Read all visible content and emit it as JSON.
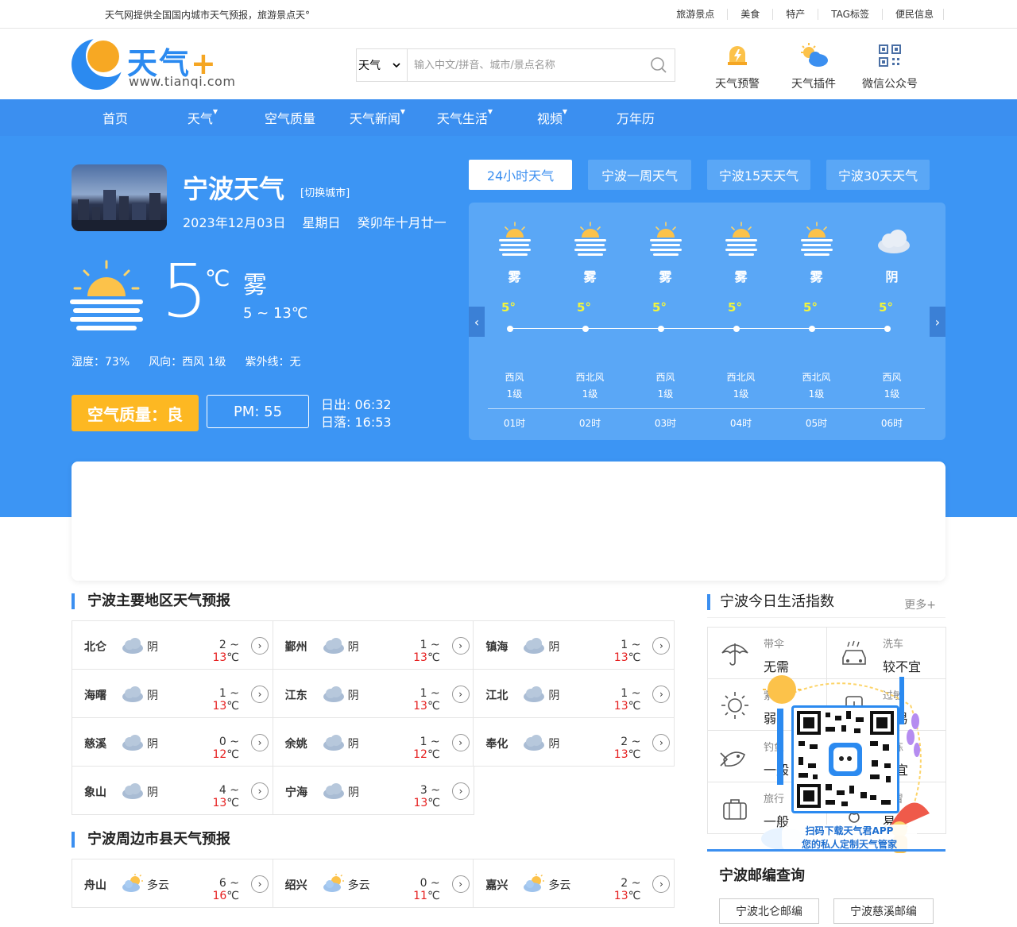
{
  "topbar": {
    "slogan": "天气网提供全国国内城市天气预报，旅游景点天°",
    "links": [
      "旅游景点",
      "美食",
      "特产",
      "TAG标签",
      "便民信息"
    ]
  },
  "logo": {
    "text_main": "天气",
    "text_plus": "+",
    "domain": "www.tianqi.com"
  },
  "search": {
    "select_value": "天气",
    "placeholder": "输入中文/拼音、城市/景点名称"
  },
  "tools": [
    {
      "label": "天气预警",
      "icon": "warning-icon"
    },
    {
      "label": "天气插件",
      "icon": "weather-plugin-icon"
    },
    {
      "label": "微信公众号",
      "icon": "qr-code-icon"
    }
  ],
  "nav": [
    {
      "label": "首页",
      "dropdown": false
    },
    {
      "label": "天气",
      "dropdown": true
    },
    {
      "label": "空气质量",
      "dropdown": false
    },
    {
      "label": "天气新闻",
      "dropdown": true
    },
    {
      "label": "天气生活",
      "dropdown": true
    },
    {
      "label": "视频",
      "dropdown": true
    },
    {
      "label": "万年历",
      "dropdown": false
    }
  ],
  "current": {
    "city_title": "宁波天气",
    "switch_city": "[切换城市]",
    "date": "2023年12月03日",
    "weekday": "星期日",
    "lunar": "癸卯年十月廿一",
    "temp": "5",
    "unit": "℃",
    "condition": "雾",
    "range": "5 ~ 13℃",
    "humidity": "湿度：73%",
    "wind": "风向：西风 1级",
    "uv": "紫外线：无",
    "air_quality": "空气质量：良",
    "pm": "PM: 55",
    "sunrise": "日出: 06:32",
    "sunset": "日落: 16:53"
  },
  "tabs": [
    "24小时天气",
    "宁波一周天气",
    "宁波15天天气",
    "宁波30天天气"
  ],
  "hourly": [
    {
      "cond": "雾",
      "temp": "5°",
      "wind_dir": "西风",
      "wind_lvl": "1级",
      "hour": "01时",
      "icon": "fog-icon"
    },
    {
      "cond": "雾",
      "temp": "5°",
      "wind_dir": "西北风",
      "wind_lvl": "1级",
      "hour": "02时",
      "icon": "fog-icon"
    },
    {
      "cond": "雾",
      "temp": "5°",
      "wind_dir": "西风",
      "wind_lvl": "1级",
      "hour": "03时",
      "icon": "fog-icon"
    },
    {
      "cond": "雾",
      "temp": "5°",
      "wind_dir": "西北风",
      "wind_lvl": "1级",
      "hour": "04时",
      "icon": "fog-icon"
    },
    {
      "cond": "雾",
      "temp": "5°",
      "wind_dir": "西北风",
      "wind_lvl": "1级",
      "hour": "05时",
      "icon": "fog-icon"
    },
    {
      "cond": "阴",
      "temp": "5°",
      "wind_dir": "西风",
      "wind_lvl": "1级",
      "hour": "06时",
      "icon": "overcast-icon"
    }
  ],
  "main_areas": {
    "title": "宁波主要地区天气预报",
    "items": [
      {
        "name": "北仑",
        "cond": "阴",
        "low": "2 ~ ",
        "high": "13",
        "unit": "℃"
      },
      {
        "name": "鄞州",
        "cond": "阴",
        "low": "1 ~ ",
        "high": "13",
        "unit": "℃"
      },
      {
        "name": "镇海",
        "cond": "阴",
        "low": "1 ~ ",
        "high": "13",
        "unit": "℃"
      },
      {
        "name": "海曙",
        "cond": "阴",
        "low": "1 ~ ",
        "high": "13",
        "unit": "℃"
      },
      {
        "name": "江东",
        "cond": "阴",
        "low": "1 ~ ",
        "high": "13",
        "unit": "℃"
      },
      {
        "name": "江北",
        "cond": "阴",
        "low": "1 ~ ",
        "high": "13",
        "unit": "℃"
      },
      {
        "name": "慈溪",
        "cond": "阴",
        "low": "0 ~ ",
        "high": "12",
        "unit": "℃"
      },
      {
        "name": "余姚",
        "cond": "阴",
        "low": "1 ~ ",
        "high": "12",
        "unit": "℃"
      },
      {
        "name": "奉化",
        "cond": "阴",
        "low": "2 ~ ",
        "high": "13",
        "unit": "℃"
      },
      {
        "name": "象山",
        "cond": "阴",
        "low": "4 ~ ",
        "high": "13",
        "unit": "℃"
      },
      {
        "name": "宁海",
        "cond": "阴",
        "low": "3 ~ ",
        "high": "13",
        "unit": "℃"
      }
    ]
  },
  "nearby": {
    "title": "宁波周边市县天气预报",
    "items": [
      {
        "name": "舟山",
        "cond": "多云",
        "low": "6 ~ ",
        "high": "16",
        "unit": "℃"
      },
      {
        "name": "绍兴",
        "cond": "多云",
        "low": "0 ~ ",
        "high": "11",
        "unit": "℃"
      },
      {
        "name": "嘉兴",
        "cond": "多云",
        "low": "2 ~ ",
        "high": "13",
        "unit": "℃"
      }
    ]
  },
  "life_index": {
    "title": "宁波今日生活指数",
    "more": "更多+",
    "items": [
      {
        "name": "带伞",
        "value": "无需",
        "icon": "umbrella-icon"
      },
      {
        "name": "洗车",
        "value": "较不宜",
        "icon": "car-wash-icon"
      },
      {
        "name": "紫外",
        "value": "弱",
        "icon": "sun-icon"
      },
      {
        "name": "过敏",
        "value": "较易",
        "icon": "allergy-icon"
      },
      {
        "name": "钓鱼",
        "value": "一般",
        "icon": "fish-icon"
      },
      {
        "name": "晨练",
        "value": "适宜",
        "icon": "exercise-icon"
      },
      {
        "name": "旅行",
        "value": "一般",
        "icon": "suitcase-icon"
      },
      {
        "name": "感冒",
        "value": "易发",
        "icon": "cold-icon"
      }
    ]
  },
  "qr_popup": {
    "line1": "扫码下载天气君APP",
    "line2": "您的私人定制天气管家"
  },
  "zipcode": {
    "title": "宁波邮编查询",
    "buttons": [
      "宁波北仑邮编",
      "宁波慈溪邮编"
    ]
  },
  "colors": {
    "brand_blue": "#3b8ff0",
    "hero_blue": "#3c95f4",
    "air_yellow": "#fdb822",
    "temp_high_red": "#e62020"
  }
}
